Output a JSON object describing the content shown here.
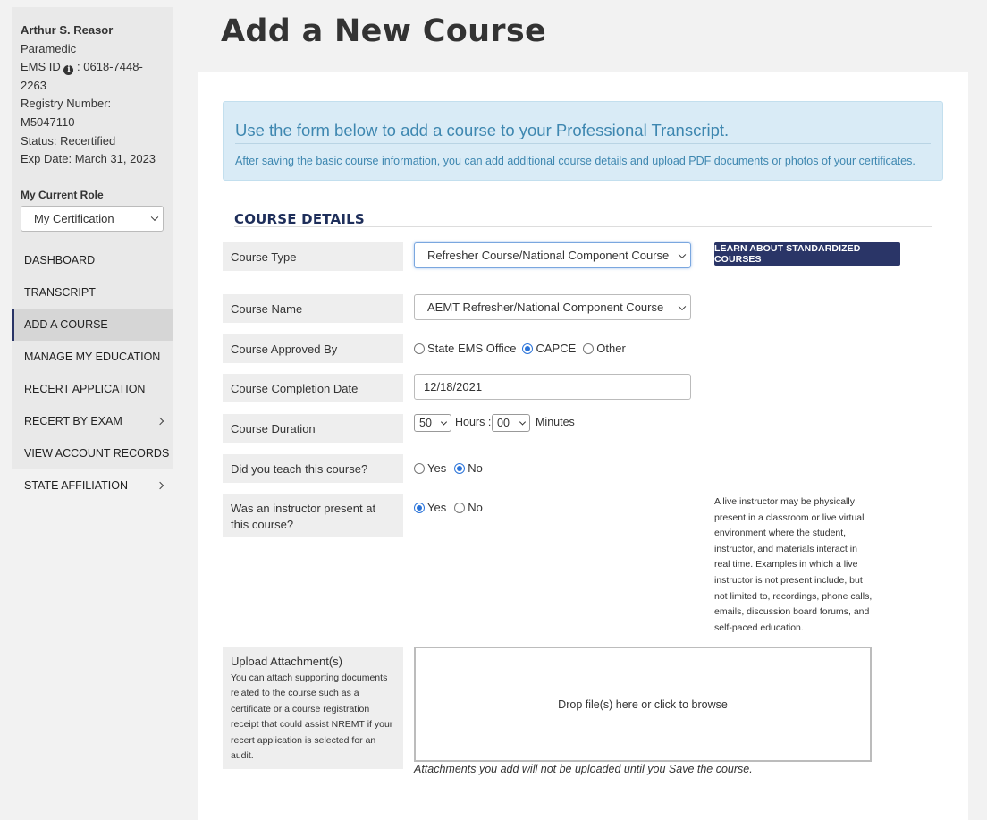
{
  "profile": {
    "name": "Arthur S. Reasor",
    "role": "Paramedic",
    "ems_id_label": "EMS ID",
    "ems_id_value": ": 0618-7448-2263",
    "registry": "Registry Number: M5047110",
    "status": "Status: Recertified",
    "exp_date": "Exp Date: March 31, 2023"
  },
  "current_role": {
    "label": "My Current Role",
    "selected": "My Certification"
  },
  "nav": {
    "items": [
      {
        "label": "DASHBOARD"
      },
      {
        "label": "TRANSCRIPT"
      },
      {
        "label": "ADD A COURSE"
      },
      {
        "label": "MANAGE MY EDUCATION"
      },
      {
        "label": "RECERT APPLICATION"
      },
      {
        "label": "RECERT BY EXAM"
      },
      {
        "label": "VIEW ACCOUNT RECORDS"
      },
      {
        "label": "STATE AFFILIATION"
      }
    ]
  },
  "page": {
    "title": "Add a New Course"
  },
  "alert": {
    "heading": "Use the form below to add a course to your Professional Transcript.",
    "text": "After saving the basic course information, you can add additional course details and upload PDF documents or photos of your certificates."
  },
  "form": {
    "section_title": "COURSE DETAILS",
    "course_type": {
      "label": "Course Type",
      "value": "Refresher Course/National Component Course",
      "learn_button": "LEARN ABOUT STANDARDIZED COURSES"
    },
    "course_name": {
      "label": "Course Name",
      "value": "AEMT Refresher/National Component Course"
    },
    "approved_by": {
      "label": "Course Approved By",
      "options": [
        "State EMS Office",
        "CAPCE",
        "Other"
      ],
      "selected": "CAPCE"
    },
    "completion_date": {
      "label": "Course Completion Date",
      "value": "12/18/2021"
    },
    "duration": {
      "label": "Course Duration",
      "hours": "50",
      "hours_label": "Hours :",
      "minutes": "00",
      "minutes_label": "Minutes"
    },
    "taught": {
      "label": "Did you teach this course?",
      "yes": "Yes",
      "no": "No",
      "selected": "No"
    },
    "instructor_present": {
      "label": "Was an instructor present at this course?",
      "yes": "Yes",
      "no": "No",
      "selected": "Yes",
      "help": "A live instructor may be physically present in a classroom or live virtual environment where the student, instructor, and materials interact in real time. Examples in which a live instructor is not present include, but not limited to, recordings, phone calls, emails, discussion board forums, and self-paced education."
    },
    "upload": {
      "label": "Upload Attachment(s)",
      "description": "You can attach supporting documents related to the course such as a certificate or a course registration receipt that could assist NREMT if your recert application is selected for an audit.",
      "dropzone": "Drop file(s) here or click to browse",
      "note": "Attachments you add will not be uploaded until you Save the course."
    }
  },
  "colors": {
    "nav_active_accent": "#2a3567",
    "button_bg": "#2a3567",
    "alert_bg": "#d9ebf6",
    "alert_text": "#3e87b0",
    "radio_selected": "#2a73d9"
  }
}
